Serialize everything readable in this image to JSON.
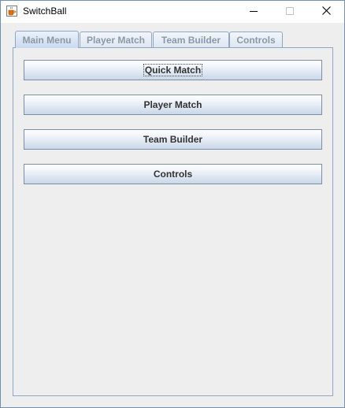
{
  "window": {
    "title": "SwitchBall"
  },
  "tabs": [
    {
      "label": "Main Menu",
      "selected": true
    },
    {
      "label": "Player Match",
      "selected": false
    },
    {
      "label": "Team Builder",
      "selected": false
    },
    {
      "label": "Controls",
      "selected": false
    }
  ],
  "main_menu": {
    "buttons": [
      {
        "label": "Quick Match",
        "focused": true
      },
      {
        "label": "Player Match",
        "focused": false
      },
      {
        "label": "Team Builder",
        "focused": false
      },
      {
        "label": "Controls",
        "focused": false
      }
    ]
  },
  "icons": {
    "app": "java-cup-icon",
    "minimize": "minimize-icon",
    "maximize": "maximize-icon",
    "close": "close-icon"
  },
  "colors": {
    "tab_border": "#8ea7c7",
    "button_border": "#7a8ea8",
    "background": "#eeeeee"
  }
}
